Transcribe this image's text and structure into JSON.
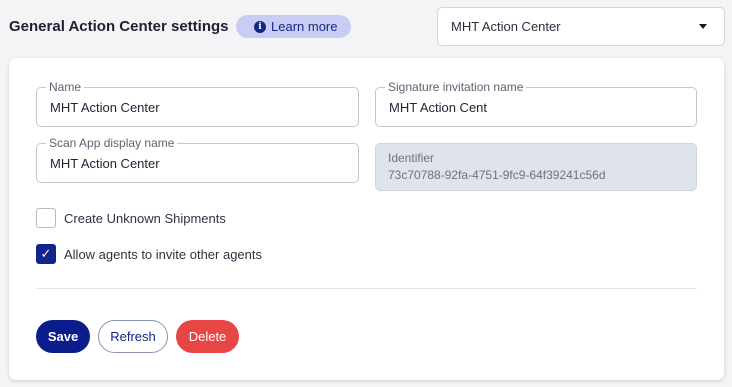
{
  "header": {
    "title": "General Action Center settings",
    "learn_more_label": "Learn more",
    "info_icon": "info-icon"
  },
  "center_select": {
    "value": "MHT Action Center",
    "icon": "caret-down-icon"
  },
  "form": {
    "name": {
      "label": "Name",
      "value": "MHT Action Center"
    },
    "signature": {
      "label": "Signature invitation name",
      "value": "MHT Action Cent"
    },
    "scan_app": {
      "label": "Scan App display name",
      "value": "MHT Action Center"
    },
    "identifier": {
      "label": "Identifier",
      "value": "73c70788-92fa-4751-9fc9-64f39241c56d"
    }
  },
  "checkboxes": {
    "create_unknown": {
      "label": "Create Unknown Shipments",
      "checked": false
    },
    "allow_agents": {
      "label": "Allow agents to invite other agents",
      "checked": true,
      "check_glyph": "✓"
    }
  },
  "actions": {
    "save_label": "Save",
    "refresh_label": "Refresh",
    "delete_label": "Delete"
  },
  "colors": {
    "primary": "#0b1c8c",
    "danger": "#e84545",
    "pill_bg": "#c9cdf3"
  }
}
